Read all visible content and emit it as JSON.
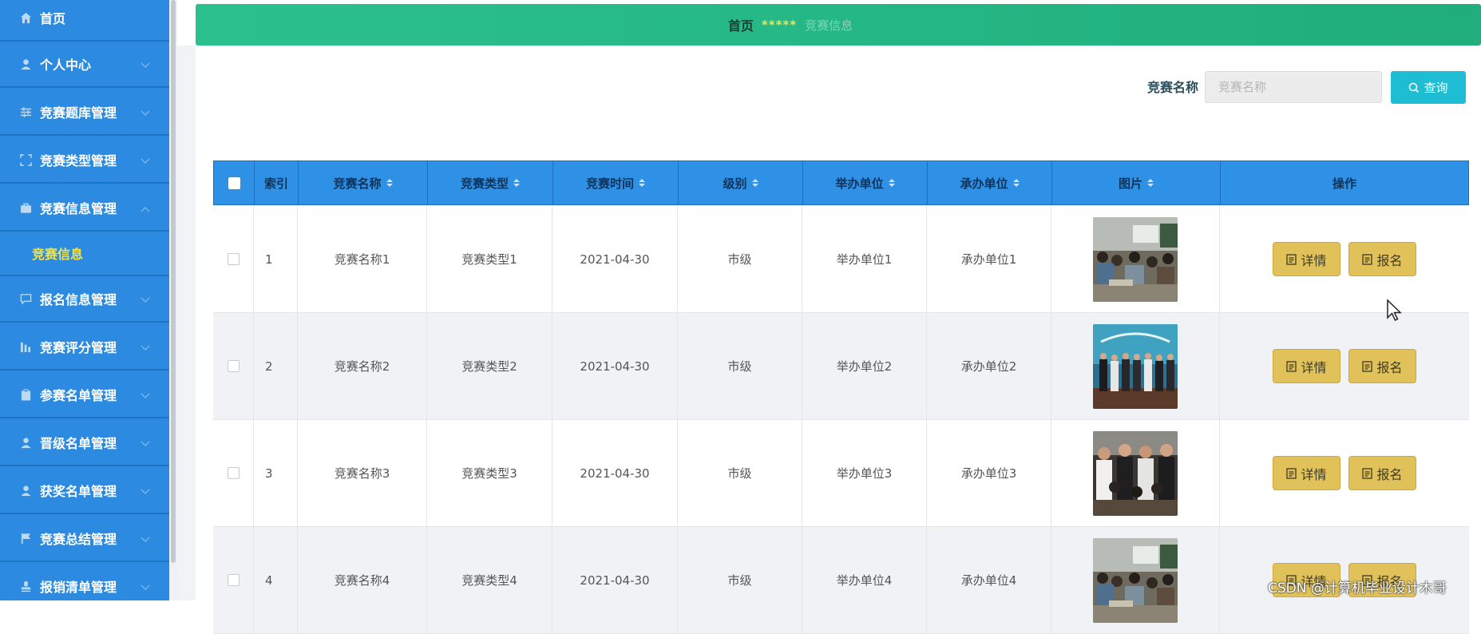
{
  "sidebar": {
    "items": [
      {
        "label": "首页",
        "icon": "home-icon"
      },
      {
        "label": "个人中心",
        "icon": "user-icon"
      },
      {
        "label": "竞赛题库管理",
        "icon": "sliders-icon"
      },
      {
        "label": "竞赛类型管理",
        "icon": "frame-icon"
      },
      {
        "label": "竞赛信息管理",
        "icon": "briefcase-icon",
        "expanded": true
      },
      {
        "label": "报名信息管理",
        "icon": "chat-icon"
      },
      {
        "label": "竞赛评分管理",
        "icon": "bar-chart-icon"
      },
      {
        "label": "参赛名单管理",
        "icon": "clipboard-icon"
      },
      {
        "label": "晋级名单管理",
        "icon": "user-icon"
      },
      {
        "label": "获奖名单管理",
        "icon": "user-icon"
      },
      {
        "label": "竞赛总结管理",
        "icon": "flag-icon"
      },
      {
        "label": "报销清单管理",
        "icon": "stamp-icon"
      }
    ],
    "submenu": {
      "label": "竞赛信息"
    }
  },
  "breadcrumb": {
    "home": "首页",
    "separator": "*****",
    "current": "竞赛信息"
  },
  "search": {
    "label": "竞赛名称",
    "placeholder": "竞赛名称",
    "button_label": "查询"
  },
  "table": {
    "columns": [
      {
        "label": "",
        "sortable": false
      },
      {
        "label": "索引",
        "sortable": false
      },
      {
        "label": "竞赛名称",
        "sortable": true
      },
      {
        "label": "竞赛类型",
        "sortable": true
      },
      {
        "label": "竞赛时间",
        "sortable": true
      },
      {
        "label": "级别",
        "sortable": true
      },
      {
        "label": "举办单位",
        "sortable": true
      },
      {
        "label": "承办单位",
        "sortable": true
      },
      {
        "label": "图片",
        "sortable": true
      },
      {
        "label": "操作",
        "sortable": false
      }
    ],
    "rows": [
      {
        "index": "1",
        "name": "竞赛名称1",
        "type": "竞赛类型1",
        "time": "2021-04-30",
        "level": "市级",
        "host": "举办单位1",
        "organizer": "承办单位1",
        "photo": "classroom"
      },
      {
        "index": "2",
        "name": "竞赛名称2",
        "type": "竞赛类型2",
        "time": "2021-04-30",
        "level": "市级",
        "host": "举办单位2",
        "organizer": "承办单位2",
        "photo": "stage-group"
      },
      {
        "index": "3",
        "name": "竞赛名称3",
        "type": "竞赛类型3",
        "time": "2021-04-30",
        "level": "市级",
        "host": "举办单位3",
        "organizer": "承办单位3",
        "photo": "crowd"
      },
      {
        "index": "4",
        "name": "竞赛名称4",
        "type": "竞赛类型4",
        "time": "2021-04-30",
        "level": "市级",
        "host": "举办单位4",
        "organizer": "承办单位4",
        "photo": "classroom"
      }
    ],
    "actions": {
      "detail_label": "详情",
      "signup_label": "报名"
    }
  },
  "watermark": "CSDN @计算机毕业设计木哥",
  "colors": {
    "sidebar": "#2c8be0",
    "header": "#22b885",
    "table_header": "#2f91e6",
    "search_button": "#1fbdd3",
    "action_button": "#e1c25a",
    "submenu_text": "#f2e24a"
  }
}
